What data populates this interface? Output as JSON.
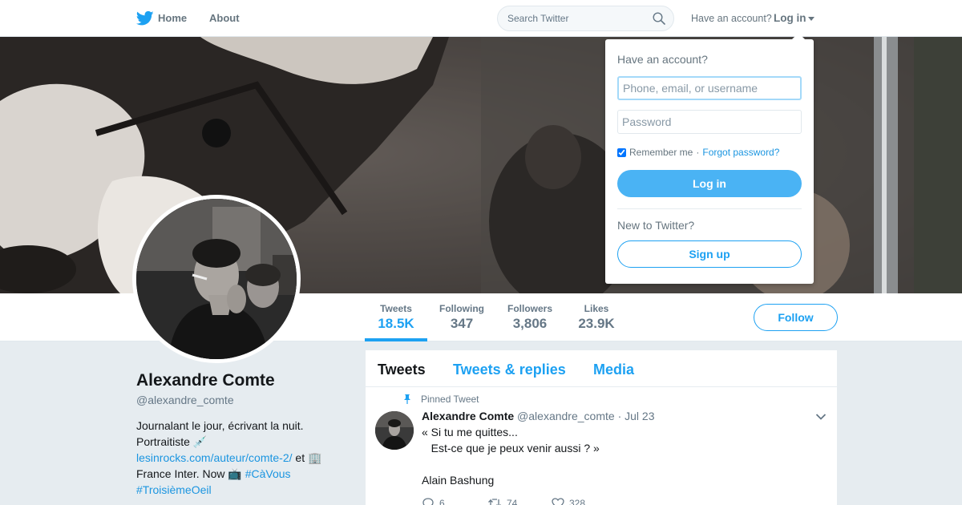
{
  "nav": {
    "home_label": "Home",
    "about_label": "About",
    "search_placeholder": "Search Twitter",
    "have_account": "Have an account?",
    "login_label": "Log in"
  },
  "colors": {
    "brand": "#1da1f2",
    "link": "#1b95e0",
    "login_button": "#4ab3f4"
  },
  "profile": {
    "name": "Alexandre Comte",
    "handle": "@alexandre_comte",
    "bio": {
      "line1": "Journalant le jour, écrivant la nuit.",
      "line2": "Portraitiste 💉",
      "link": "lesinrocks.com/auteur/comte-2/",
      "link_suffix": " et 🏢",
      "line4_prefix": "France Inter. Now 📺 ",
      "hashtag1": "#CàVous",
      "hashtag2": "#TroisièmeOeil"
    }
  },
  "stats": [
    {
      "label": "Tweets",
      "value": "18.5K",
      "active": true
    },
    {
      "label": "Following",
      "value": "347"
    },
    {
      "label": "Followers",
      "value": "3,806"
    },
    {
      "label": "Likes",
      "value": "23.9K"
    }
  ],
  "follow_label": "Follow",
  "timeline": {
    "tabs": [
      "Tweets",
      "Tweets & replies",
      "Media"
    ],
    "active_tab": "Tweets",
    "tweet": {
      "pinned_label": "Pinned Tweet",
      "author": "Alexandre Comte",
      "handle": "@alexandre_comte",
      "sep": "·",
      "date": "Jul 23",
      "lines": [
        "« Si tu me quittes...",
        "   Est-ce que je peux venir aussi ? »",
        "",
        "Alain Bashung"
      ],
      "replies": "6",
      "retweets": "74",
      "likes": "328"
    }
  },
  "login_dropdown": {
    "title": "Have an account?",
    "username_placeholder": "Phone, email, or username",
    "password_placeholder": "Password",
    "remember_label": "Remember me",
    "remember_checked": true,
    "sep": "·",
    "forgot_label": "Forgot password?",
    "login_button": "Log in",
    "new_label": "New to Twitter?",
    "signup_button": "Sign up"
  }
}
